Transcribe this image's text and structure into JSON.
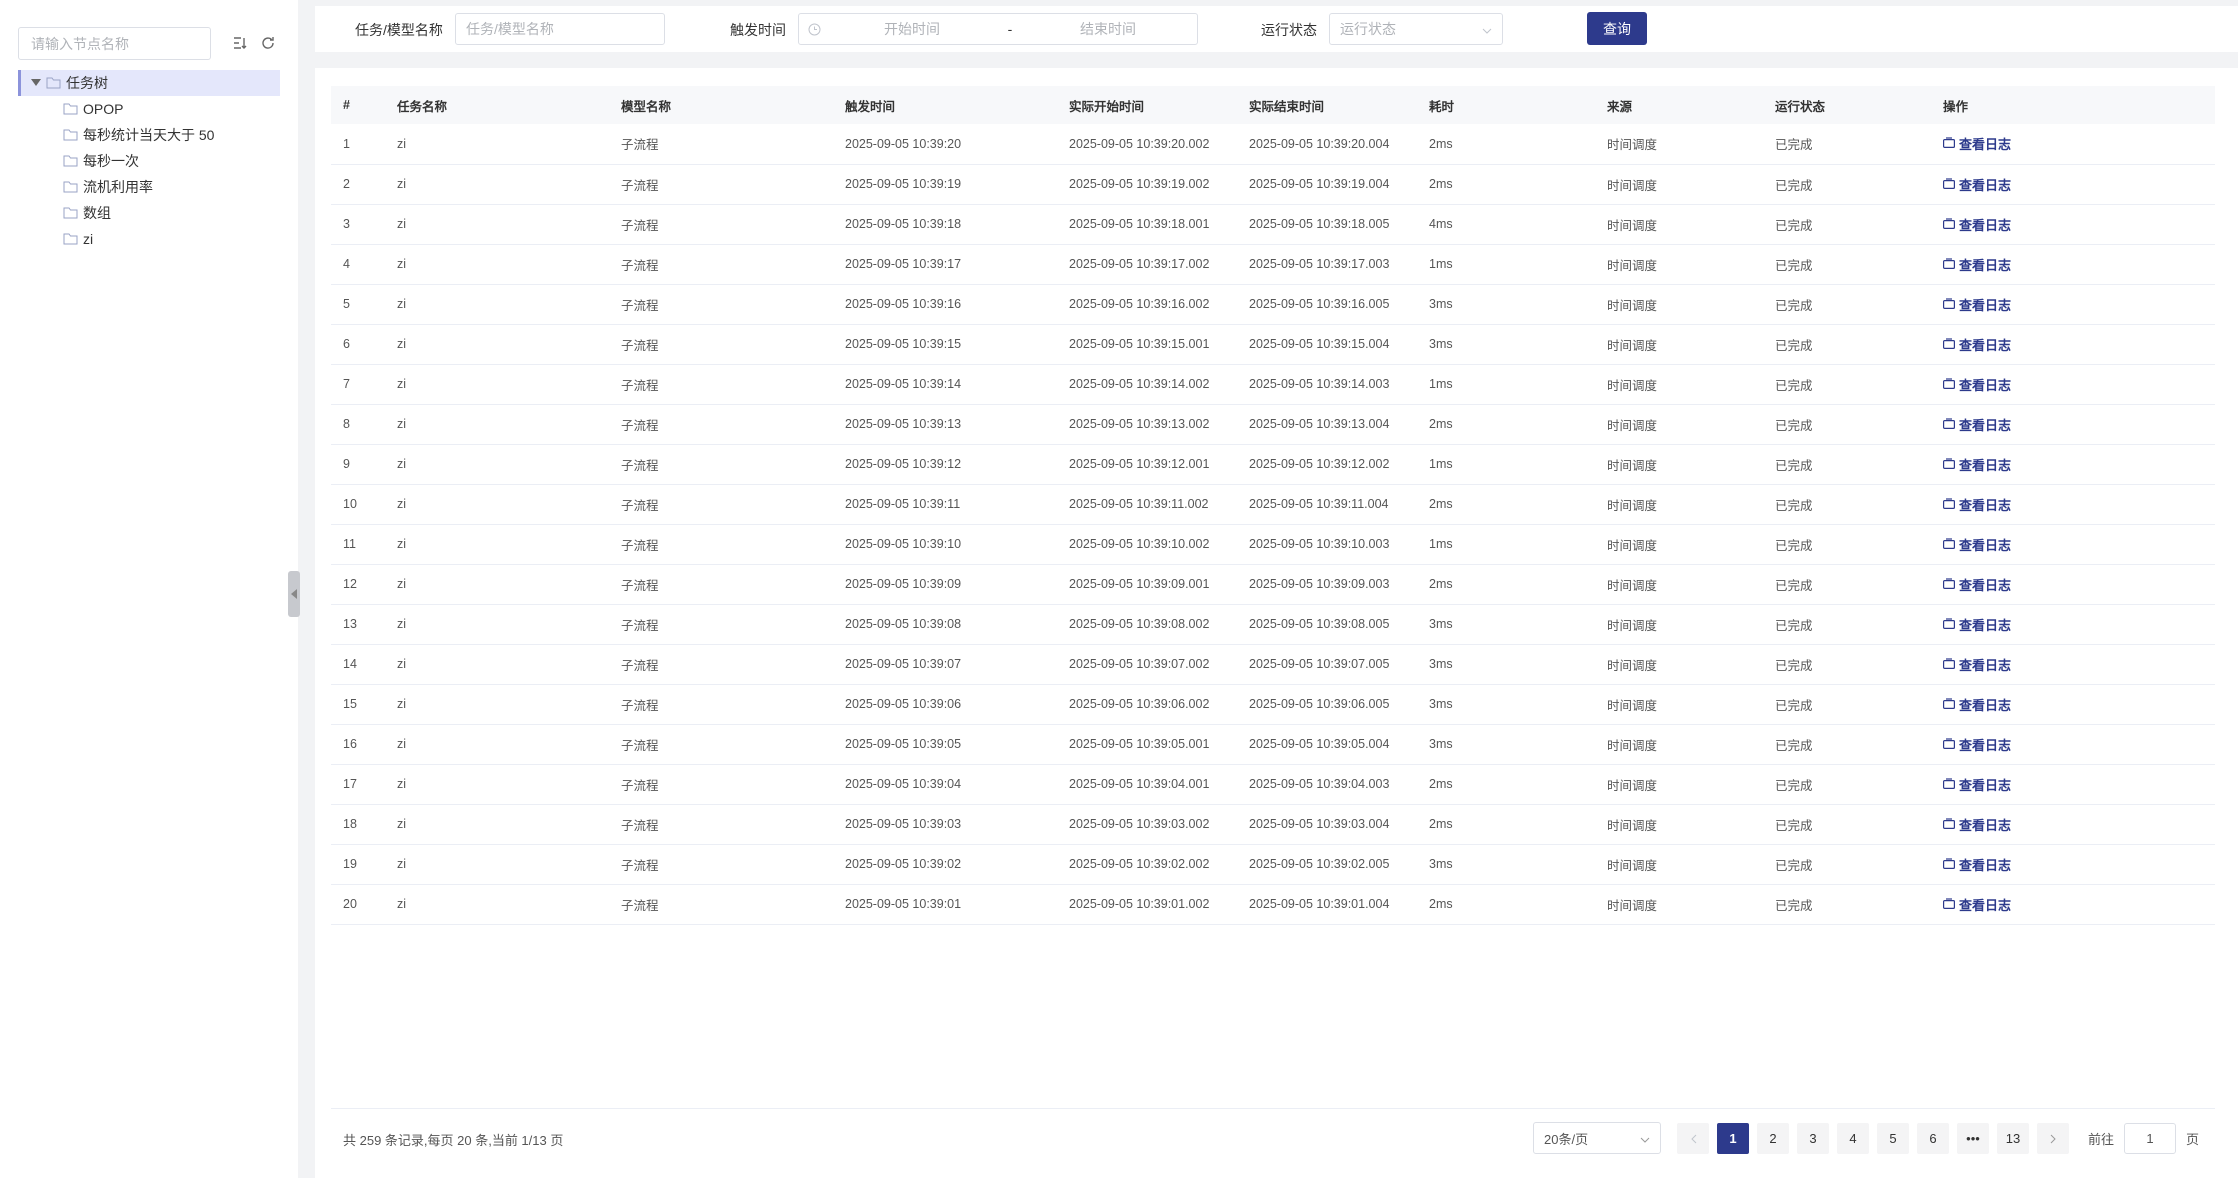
{
  "sidebar": {
    "search_placeholder": "请输入节点名称",
    "tree": {
      "root_label": "任务树",
      "children": [
        "OPOP",
        "每秒统计当天大于 50",
        "每秒一次",
        "流机利用率",
        "数组",
        "zi"
      ]
    }
  },
  "filters": {
    "task_label": "任务/模型名称",
    "task_placeholder": "任务/模型名称",
    "time_label": "触发时间",
    "start_placeholder": "开始时间",
    "range_sep": "-",
    "end_placeholder": "结束时间",
    "status_label": "运行状态",
    "status_placeholder": "运行状态",
    "query_label": "查询"
  },
  "table": {
    "headers": [
      "#",
      "任务名称",
      "模型名称",
      "触发时间",
      "实际开始时间",
      "实际结束时间",
      "耗时",
      "来源",
      "运行状态",
      "操作"
    ],
    "action_label": "查看日志",
    "rows": [
      [
        "1",
        "zi",
        "子流程",
        "2025-09-05 10:39:20",
        "2025-09-05 10:39:20.002",
        "2025-09-05 10:39:20.004",
        "2ms",
        "时间调度",
        "已完成"
      ],
      [
        "2",
        "zi",
        "子流程",
        "2025-09-05 10:39:19",
        "2025-09-05 10:39:19.002",
        "2025-09-05 10:39:19.004",
        "2ms",
        "时间调度",
        "已完成"
      ],
      [
        "3",
        "zi",
        "子流程",
        "2025-09-05 10:39:18",
        "2025-09-05 10:39:18.001",
        "2025-09-05 10:39:18.005",
        "4ms",
        "时间调度",
        "已完成"
      ],
      [
        "4",
        "zi",
        "子流程",
        "2025-09-05 10:39:17",
        "2025-09-05 10:39:17.002",
        "2025-09-05 10:39:17.003",
        "1ms",
        "时间调度",
        "已完成"
      ],
      [
        "5",
        "zi",
        "子流程",
        "2025-09-05 10:39:16",
        "2025-09-05 10:39:16.002",
        "2025-09-05 10:39:16.005",
        "3ms",
        "时间调度",
        "已完成"
      ],
      [
        "6",
        "zi",
        "子流程",
        "2025-09-05 10:39:15",
        "2025-09-05 10:39:15.001",
        "2025-09-05 10:39:15.004",
        "3ms",
        "时间调度",
        "已完成"
      ],
      [
        "7",
        "zi",
        "子流程",
        "2025-09-05 10:39:14",
        "2025-09-05 10:39:14.002",
        "2025-09-05 10:39:14.003",
        "1ms",
        "时间调度",
        "已完成"
      ],
      [
        "8",
        "zi",
        "子流程",
        "2025-09-05 10:39:13",
        "2025-09-05 10:39:13.002",
        "2025-09-05 10:39:13.004",
        "2ms",
        "时间调度",
        "已完成"
      ],
      [
        "9",
        "zi",
        "子流程",
        "2025-09-05 10:39:12",
        "2025-09-05 10:39:12.001",
        "2025-09-05 10:39:12.002",
        "1ms",
        "时间调度",
        "已完成"
      ],
      [
        "10",
        "zi",
        "子流程",
        "2025-09-05 10:39:11",
        "2025-09-05 10:39:11.002",
        "2025-09-05 10:39:11.004",
        "2ms",
        "时间调度",
        "已完成"
      ],
      [
        "11",
        "zi",
        "子流程",
        "2025-09-05 10:39:10",
        "2025-09-05 10:39:10.002",
        "2025-09-05 10:39:10.003",
        "1ms",
        "时间调度",
        "已完成"
      ],
      [
        "12",
        "zi",
        "子流程",
        "2025-09-05 10:39:09",
        "2025-09-05 10:39:09.001",
        "2025-09-05 10:39:09.003",
        "2ms",
        "时间调度",
        "已完成"
      ],
      [
        "13",
        "zi",
        "子流程",
        "2025-09-05 10:39:08",
        "2025-09-05 10:39:08.002",
        "2025-09-05 10:39:08.005",
        "3ms",
        "时间调度",
        "已完成"
      ],
      [
        "14",
        "zi",
        "子流程",
        "2025-09-05 10:39:07",
        "2025-09-05 10:39:07.002",
        "2025-09-05 10:39:07.005",
        "3ms",
        "时间调度",
        "已完成"
      ],
      [
        "15",
        "zi",
        "子流程",
        "2025-09-05 10:39:06",
        "2025-09-05 10:39:06.002",
        "2025-09-05 10:39:06.005",
        "3ms",
        "时间调度",
        "已完成"
      ],
      [
        "16",
        "zi",
        "子流程",
        "2025-09-05 10:39:05",
        "2025-09-05 10:39:05.001",
        "2025-09-05 10:39:05.004",
        "3ms",
        "时间调度",
        "已完成"
      ],
      [
        "17",
        "zi",
        "子流程",
        "2025-09-05 10:39:04",
        "2025-09-05 10:39:04.001",
        "2025-09-05 10:39:04.003",
        "2ms",
        "时间调度",
        "已完成"
      ],
      [
        "18",
        "zi",
        "子流程",
        "2025-09-05 10:39:03",
        "2025-09-05 10:39:03.002",
        "2025-09-05 10:39:03.004",
        "2ms",
        "时间调度",
        "已完成"
      ],
      [
        "19",
        "zi",
        "子流程",
        "2025-09-05 10:39:02",
        "2025-09-05 10:39:02.002",
        "2025-09-05 10:39:02.005",
        "3ms",
        "时间调度",
        "已完成"
      ],
      [
        "20",
        "zi",
        "子流程",
        "2025-09-05 10:39:01",
        "2025-09-05 10:39:01.002",
        "2025-09-05 10:39:01.004",
        "2ms",
        "时间调度",
        "已完成"
      ]
    ]
  },
  "pagination": {
    "summary": "共  259  条记录,每页  20  条,当前  1/13  页",
    "page_size": "20条/页",
    "pages": [
      "1",
      "2",
      "3",
      "4",
      "5",
      "6",
      "•••",
      "13"
    ],
    "current_page": "1",
    "goto_prefix": "前往",
    "goto_value": "1",
    "goto_suffix": "页"
  },
  "colors": {
    "primary": "#2d3a8c",
    "tree_selected_bg": "#e4e7fb",
    "header_bg": "#f7f8fa"
  },
  "icons": {
    "tree_tools": [
      "expand-collapse-icon",
      "refresh-icon"
    ],
    "folder": "folder-icon",
    "log": "monitor-icon"
  }
}
